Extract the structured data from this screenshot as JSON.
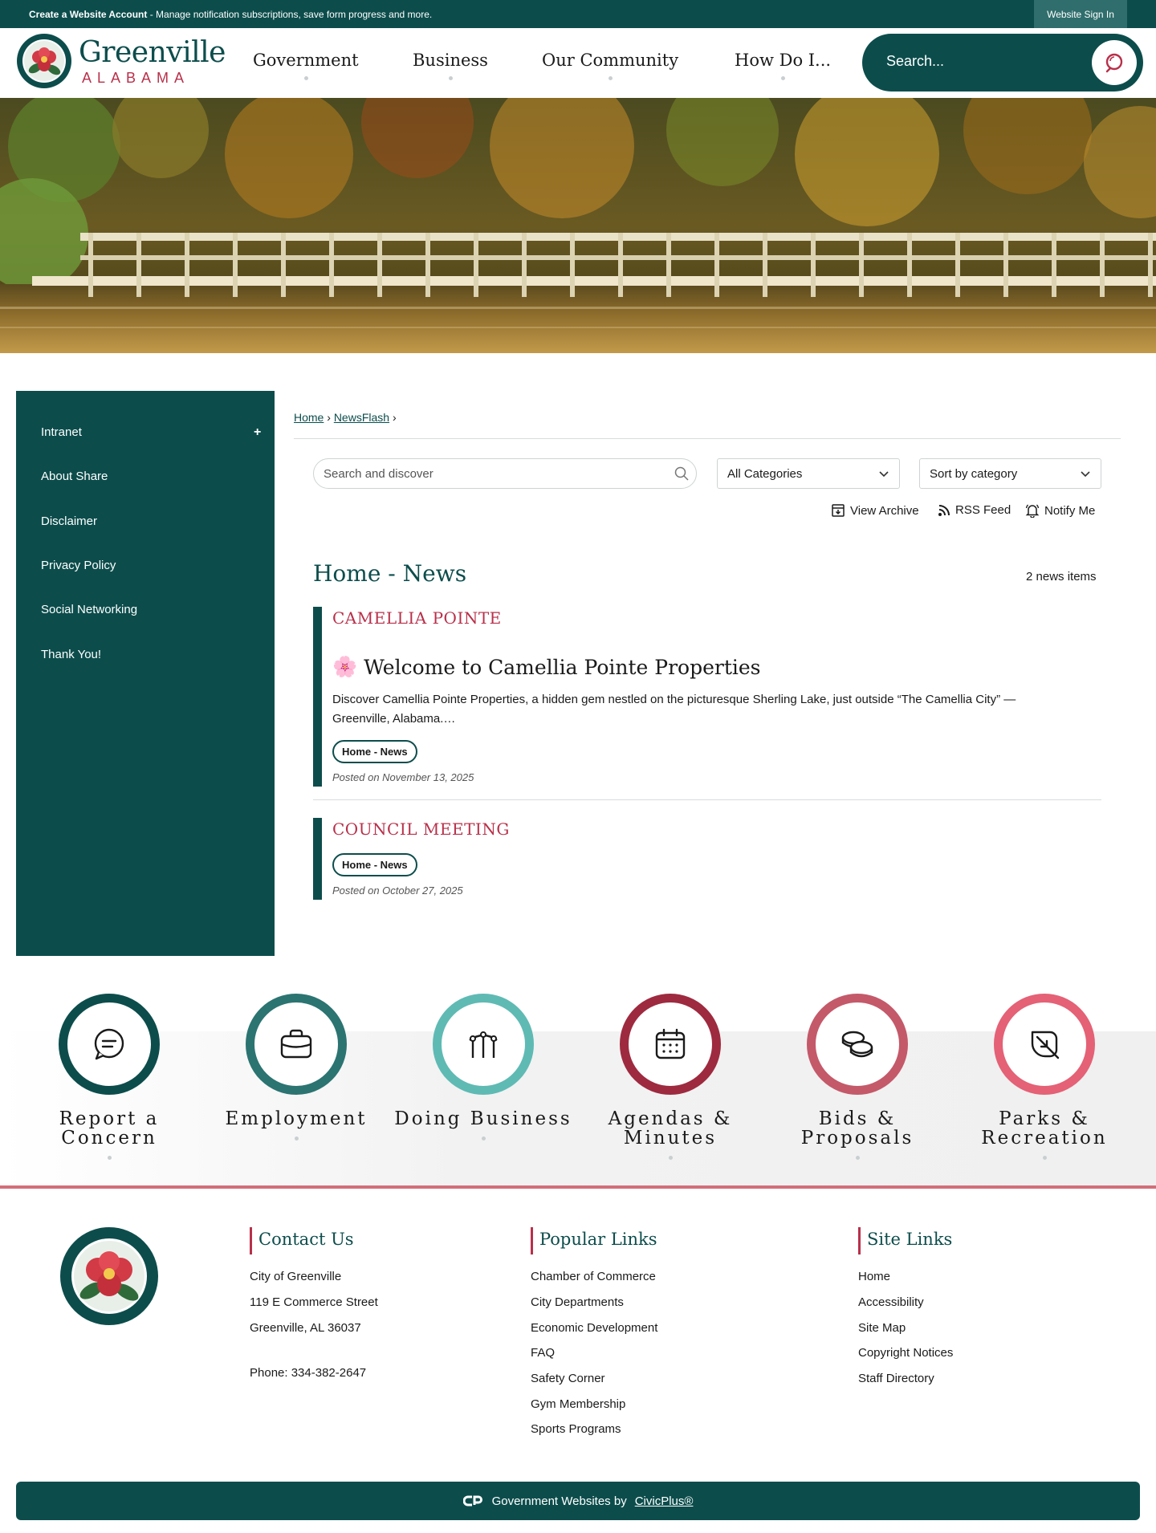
{
  "topbar": {
    "create_label": "Create a Website Account",
    "create_desc": " - Manage notification subscriptions, save form progress and more.",
    "signin": "Website Sign In"
  },
  "header": {
    "logo_name": "Greenville",
    "logo_state": "ALABAMA",
    "nav": [
      "Government",
      "Business",
      "Our Community",
      "How Do I..."
    ],
    "search_placeholder": "Search..."
  },
  "sidebar": {
    "items": [
      "Intranet",
      "About Share",
      "Disclaimer",
      "Privacy Policy",
      "Social Networking",
      "Thank You!"
    ],
    "expand_symbol": "+"
  },
  "breadcrumb": {
    "home": "Home",
    "newsflash": "NewsFlash",
    "sep": "›"
  },
  "filters": {
    "search_placeholder": "Search and discover",
    "category": "All Categories",
    "sort": "Sort by category",
    "view_archive": "View Archive",
    "rss_feed": "RSS Feed",
    "notify_me": "Notify Me"
  },
  "news": {
    "title": "Home - News",
    "count": "2 news items",
    "items": [
      {
        "category": "CAMELLIA POINTE",
        "headline": "Welcome to Camellia Pointe Properties",
        "emoji": "🌸",
        "desc": "Discover Camellia Pointe Properties, a hidden gem nestled on the picturesque Sherling Lake, just outside “The Camellia City” — Greenville, Alabama.…",
        "tag": "Home - News",
        "posted": "Posted on November 13, 2025"
      },
      {
        "category": "COUNCIL MEETING",
        "tag": "Home - News",
        "posted": "Posted on October 27, 2025"
      }
    ]
  },
  "quick_links": [
    {
      "label": "Report a Concern",
      "icon": "chat-bubble-icon",
      "color": "#0c4d4c"
    },
    {
      "label": "Employment",
      "icon": "briefcase-icon",
      "color": "#2b7471"
    },
    {
      "label": "Doing Business",
      "icon": "lights-icon",
      "color": "#5fbab4"
    },
    {
      "label": "Agendas & Minutes",
      "icon": "calendar-icon",
      "color": "#9e2a3f"
    },
    {
      "label": "Bids & Proposals",
      "icon": "coins-icon",
      "color": "#c4596a"
    },
    {
      "label": "Parks & Recreation",
      "icon": "leaf-icon",
      "color": "#e46176"
    }
  ],
  "footer": {
    "contact": {
      "title": "Contact Us",
      "lines": [
        "City of Greenville",
        "119 E Commerce Street",
        "Greenville, AL 36037"
      ],
      "phone": "Phone: 334-382-2647"
    },
    "popular": {
      "title": "Popular Links",
      "links": [
        "Chamber of Commerce",
        "City Departments",
        "Economic Development",
        "FAQ",
        "Safety Corner",
        "Gym Membership",
        "Sports Programs"
      ]
    },
    "site": {
      "title": "Site Links",
      "links": [
        "Home",
        "Accessibility",
        "Site Map",
        "Copyright Notices",
        "Staff Directory"
      ]
    },
    "civic_text": "Government Websites by",
    "civic_link": "CivicPlus®"
  },
  "colors": {
    "primary": "#0c4d4c",
    "accent": "#b8304a"
  }
}
